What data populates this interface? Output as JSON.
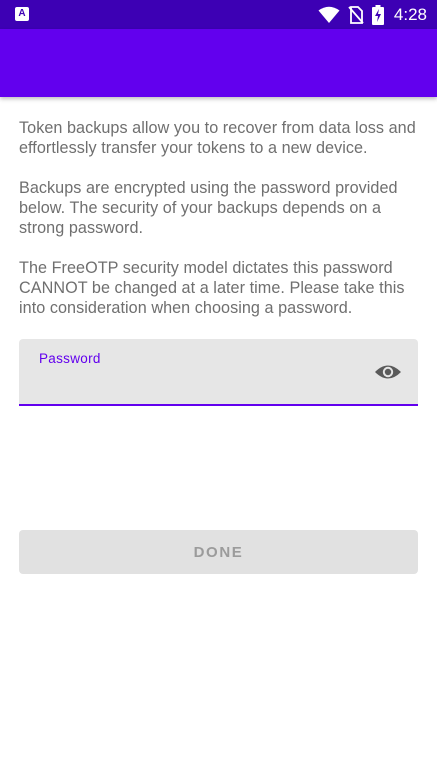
{
  "status_bar": {
    "time": "4:28",
    "notification_icon": "accessibility-a-icon",
    "icons": [
      "wifi-icon",
      "no-sim-icon",
      "battery-charging-icon"
    ]
  },
  "app_bar": {
    "title": ""
  },
  "content": {
    "paragraphs": [
      "Token backups allow you to recover from data loss and effortlessly transfer your tokens to a new device.",
      "Backups are encrypted using the password provided below. The security of your backups depends on a strong password.",
      "The FreeOTP security model dictates this password CANNOT be changed at a later time. Please take this into consideration when choosing a password."
    ]
  },
  "password_field": {
    "label": "Password",
    "value": "",
    "toggle_icon": "eye-icon"
  },
  "done_button": {
    "label": "DONE",
    "enabled": false
  },
  "colors": {
    "status_bar": "#3d00b4",
    "app_bar": "#6200ee",
    "accent": "#6200ee",
    "body_text": "#6f6f6f",
    "field_bg": "#e6e6e6",
    "button_disabled_bg": "#e1e1e1",
    "button_disabled_text": "#9b9b9b"
  }
}
